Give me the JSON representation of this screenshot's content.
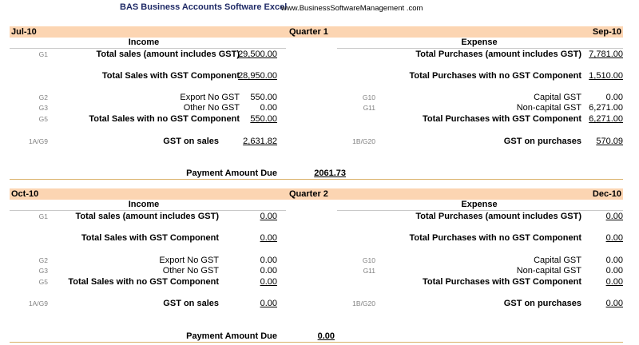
{
  "header": {
    "title": "BAS Business Accounts Software Excel",
    "url": "www.BusinessSoftwareManagement .com"
  },
  "quarters": [
    {
      "start": "Jul-10",
      "name": "Quarter 1",
      "end": "Sep-10",
      "income_title": "Income",
      "expense_title": "Expense",
      "income": {
        "total_sales": {
          "code": "G1",
          "label": "Total sales (amount includes GST)",
          "value": "29,500.00"
        },
        "sales_gst": {
          "label": "Total Sales with GST Component",
          "value": "28,950.00"
        },
        "export": {
          "code": "G2",
          "label": "Export No GST",
          "value": "550.00"
        },
        "other": {
          "code": "G3",
          "label": "Other No GST",
          "value": "0.00"
        },
        "no_gst": {
          "code": "G5",
          "label": "Total Sales with no GST Component",
          "value": "550.00"
        },
        "gst": {
          "code": "1A/G9",
          "label": "GST on sales",
          "value": "2,631.82"
        }
      },
      "expense": {
        "total_purchases": {
          "label": "Total Purchases (amount includes GST)",
          "value": "7,781.00"
        },
        "no_gst_purchases": {
          "label": "Total Purchases with no GST Component",
          "value": "1,510.00"
        },
        "capital": {
          "code": "G10",
          "label": "Capital GST",
          "value": "0.00"
        },
        "noncapital": {
          "code": "G11",
          "label": "Non-capital GST",
          "value": "6,271.00"
        },
        "gst_comp": {
          "label": "Total Purchases with GST Component",
          "value": "6,271.00"
        },
        "gst": {
          "code": "1B/G20",
          "label": "GST on purchases",
          "value": "570.09"
        }
      },
      "payment": {
        "label": "Payment Amount Due",
        "value": "2061.73"
      }
    },
    {
      "start": "Oct-10",
      "name": "Quarter 2",
      "end": "Dec-10",
      "income_title": "Income",
      "expense_title": "Expense",
      "income": {
        "total_sales": {
          "code": "G1",
          "label": "Total sales (amount includes GST)",
          "value": "0.00"
        },
        "sales_gst": {
          "label": "Total Sales with GST Component",
          "value": "0.00"
        },
        "export": {
          "code": "G2",
          "label": "Export No GST",
          "value": "0.00"
        },
        "other": {
          "code": "G3",
          "label": "Other No GST",
          "value": "0.00"
        },
        "no_gst": {
          "code": "G5",
          "label": "Total Sales with no GST Component",
          "value": "0.00"
        },
        "gst": {
          "code": "1A/G9",
          "label": "GST on sales",
          "value": "0.00"
        }
      },
      "expense": {
        "total_purchases": {
          "label": "Total Purchases (amount includes GST)",
          "value": "0.00"
        },
        "no_gst_purchases": {
          "label": "Total Purchases with no GST Component",
          "value": "0.00"
        },
        "capital": {
          "code": "G10",
          "label": "Capital GST",
          "value": "0.00"
        },
        "noncapital": {
          "code": "G11",
          "label": "Non-capital GST",
          "value": "0.00"
        },
        "gst_comp": {
          "label": "Total Purchases with GST Component",
          "value": "0.00"
        },
        "gst": {
          "code": "1B/G20",
          "label": "GST on purchases",
          "value": "0.00"
        }
      },
      "payment": {
        "label": "Payment Amount Due",
        "value": "0.00"
      }
    }
  ]
}
